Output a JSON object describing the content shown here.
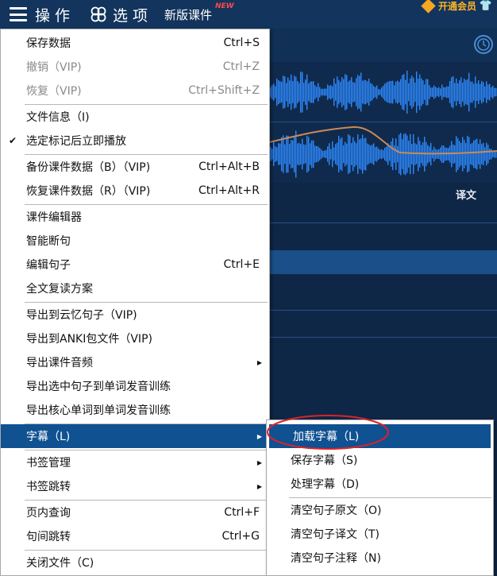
{
  "topbar": {
    "operation": "操 作",
    "options": "选 项",
    "new_courseware": "新版课件",
    "new_badge": "NEW",
    "vip": "开通会员"
  },
  "background": {
    "translation_label": "译文"
  },
  "main_menu": {
    "items": [
      {
        "label": "保存数据",
        "shortcut": "Ctrl+S"
      },
      {
        "label": "撤销（VIP)",
        "shortcut": "Ctrl+Z"
      },
      {
        "label": "恢复（VIP)",
        "shortcut": "Ctrl+Shift+Z"
      },
      {
        "label": "文件信息（I)",
        "shortcut": ""
      },
      {
        "label": "选定标记后立即播放",
        "shortcut": ""
      },
      {
        "label": "备份课件数据（B）（VIP)",
        "shortcut": "Ctrl+Alt+B"
      },
      {
        "label": "恢复课件数据（R）（VIP)",
        "shortcut": "Ctrl+Alt+R"
      },
      {
        "label": "课件编辑器",
        "shortcut": ""
      },
      {
        "label": "智能断句",
        "shortcut": ""
      },
      {
        "label": "编辑句子",
        "shortcut": "Ctrl+E"
      },
      {
        "label": "全文复读方案",
        "shortcut": ""
      },
      {
        "label": "导出到云忆句子（VIP)",
        "shortcut": ""
      },
      {
        "label": "导出到ANKI包文件（VIP)",
        "shortcut": ""
      },
      {
        "label": "导出课件音频",
        "shortcut": ""
      },
      {
        "label": "导出选中句子到单词发音训练",
        "shortcut": ""
      },
      {
        "label": "导出核心单词到单词发音训练",
        "shortcut": ""
      },
      {
        "label": "字幕（L)",
        "shortcut": ""
      },
      {
        "label": "书签管理",
        "shortcut": ""
      },
      {
        "label": "书签跳转",
        "shortcut": ""
      },
      {
        "label": "页内查询",
        "shortcut": "Ctrl+F"
      },
      {
        "label": "句间跳转",
        "shortcut": "Ctrl+G"
      },
      {
        "label": "关闭文件（C)",
        "shortcut": ""
      }
    ],
    "checked_item": "选定标记后立即播放",
    "highlighted_item": "字幕（L)"
  },
  "sub_menu": {
    "items": [
      {
        "label": "加载字幕（L)"
      },
      {
        "label": "保存字幕（S)"
      },
      {
        "label": "处理字幕（D)"
      },
      {
        "label": "清空句子原文（O)"
      },
      {
        "label": "清空句子译文（T)"
      },
      {
        "label": "清空句子注释（N)"
      }
    ],
    "highlighted_item": "加载字幕（L)"
  },
  "colors": {
    "menu_highlight": "#0f5191",
    "annotation_circle": "#d8232a",
    "vip_gold": "#ffb424",
    "waveform": "#2f8bff"
  },
  "icons": {
    "menu": "hamburger-icon",
    "options": "clover-icon",
    "vip": "diamond-icon",
    "shirt": "shirt-icon",
    "clock": "clock-icon",
    "check": "check-icon",
    "submenu": "triangle-right-icon"
  }
}
